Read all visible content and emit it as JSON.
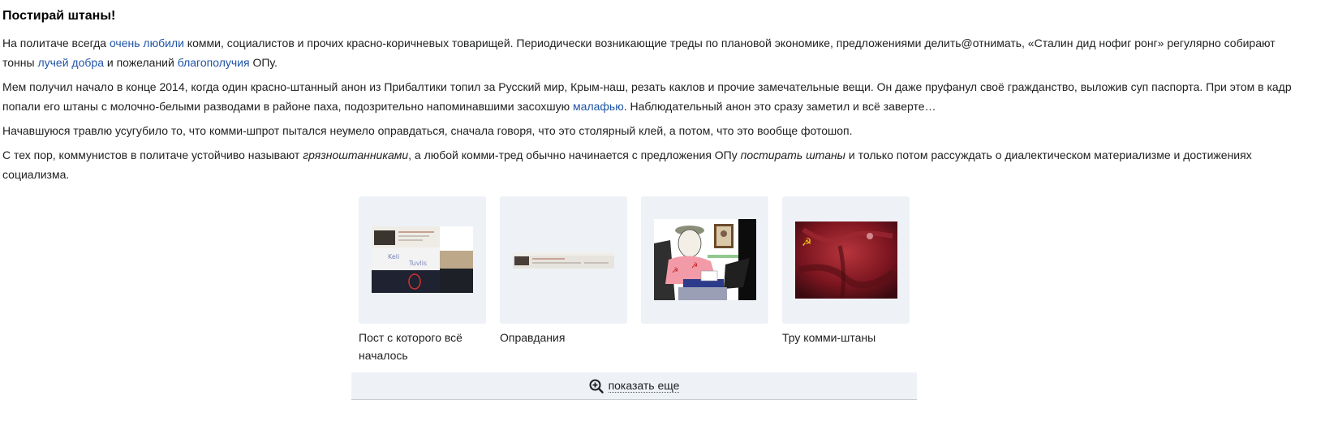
{
  "section": {
    "title": "Постирай штаны!"
  },
  "paragraphs": {
    "p1": {
      "t1": "На политаче всегда ",
      "l1": "очень любили",
      "t2": " комми, социалистов и прочих красно-коричневых товарищей. Периодически возникающие треды по плановой экономике, предложениями делить@отнимать, «Сталин дид нофиг ронг» регулярно собирают тонны ",
      "l2": "лучей добра",
      "t3": " и пожеланий ",
      "l3": "благополучия",
      "t4": " ОПу."
    },
    "p2": {
      "t1": "Мем получил начало в конце 2014, когда один красно-штанный анон из Прибалтики топил за Русский мир, Крым-наш, резать каклов и прочие замечательные вещи. Он даже пруфанул своё гражданство, выложив суп паспорта. При этом в кадр попали его штаны с молочно-белыми разводами в районе паха, подозрительно напоминавшими засохшую ",
      "l1": "малафью",
      "t2": ". Наблюдательный анон это сразу заметил и всё заверте…"
    },
    "p3": {
      "t1": "Начавшуюся травлю усугубило то, что комми-шпрот пытался неумело оправдаться, сначала говоря, что это столярный клей, а потом, что это вообще фотошоп."
    },
    "p4": {
      "t1": "С тех пор, коммунистов в политаче устойчиво называют ",
      "e1": "грязноштанниками",
      "t2": ", а любой комми-тред обычно начинается с предложения ОПу ",
      "e2": "постирать штаны",
      "t3": " и только потом рассуждать о диалектическом материализме и достижениях социализма."
    }
  },
  "gallery": {
    "items": [
      {
        "caption": "Пост с которого всё началось"
      },
      {
        "caption": "Оправдания"
      },
      {
        "caption": ""
      },
      {
        "caption": "Тру комми-штаны"
      }
    ]
  },
  "show_more": {
    "label": "показать еще",
    "icon": "zoom-in-icon"
  },
  "colors": {
    "link": "#2054a6",
    "gallery_bg": "#eef2f7",
    "text": "#202122"
  }
}
